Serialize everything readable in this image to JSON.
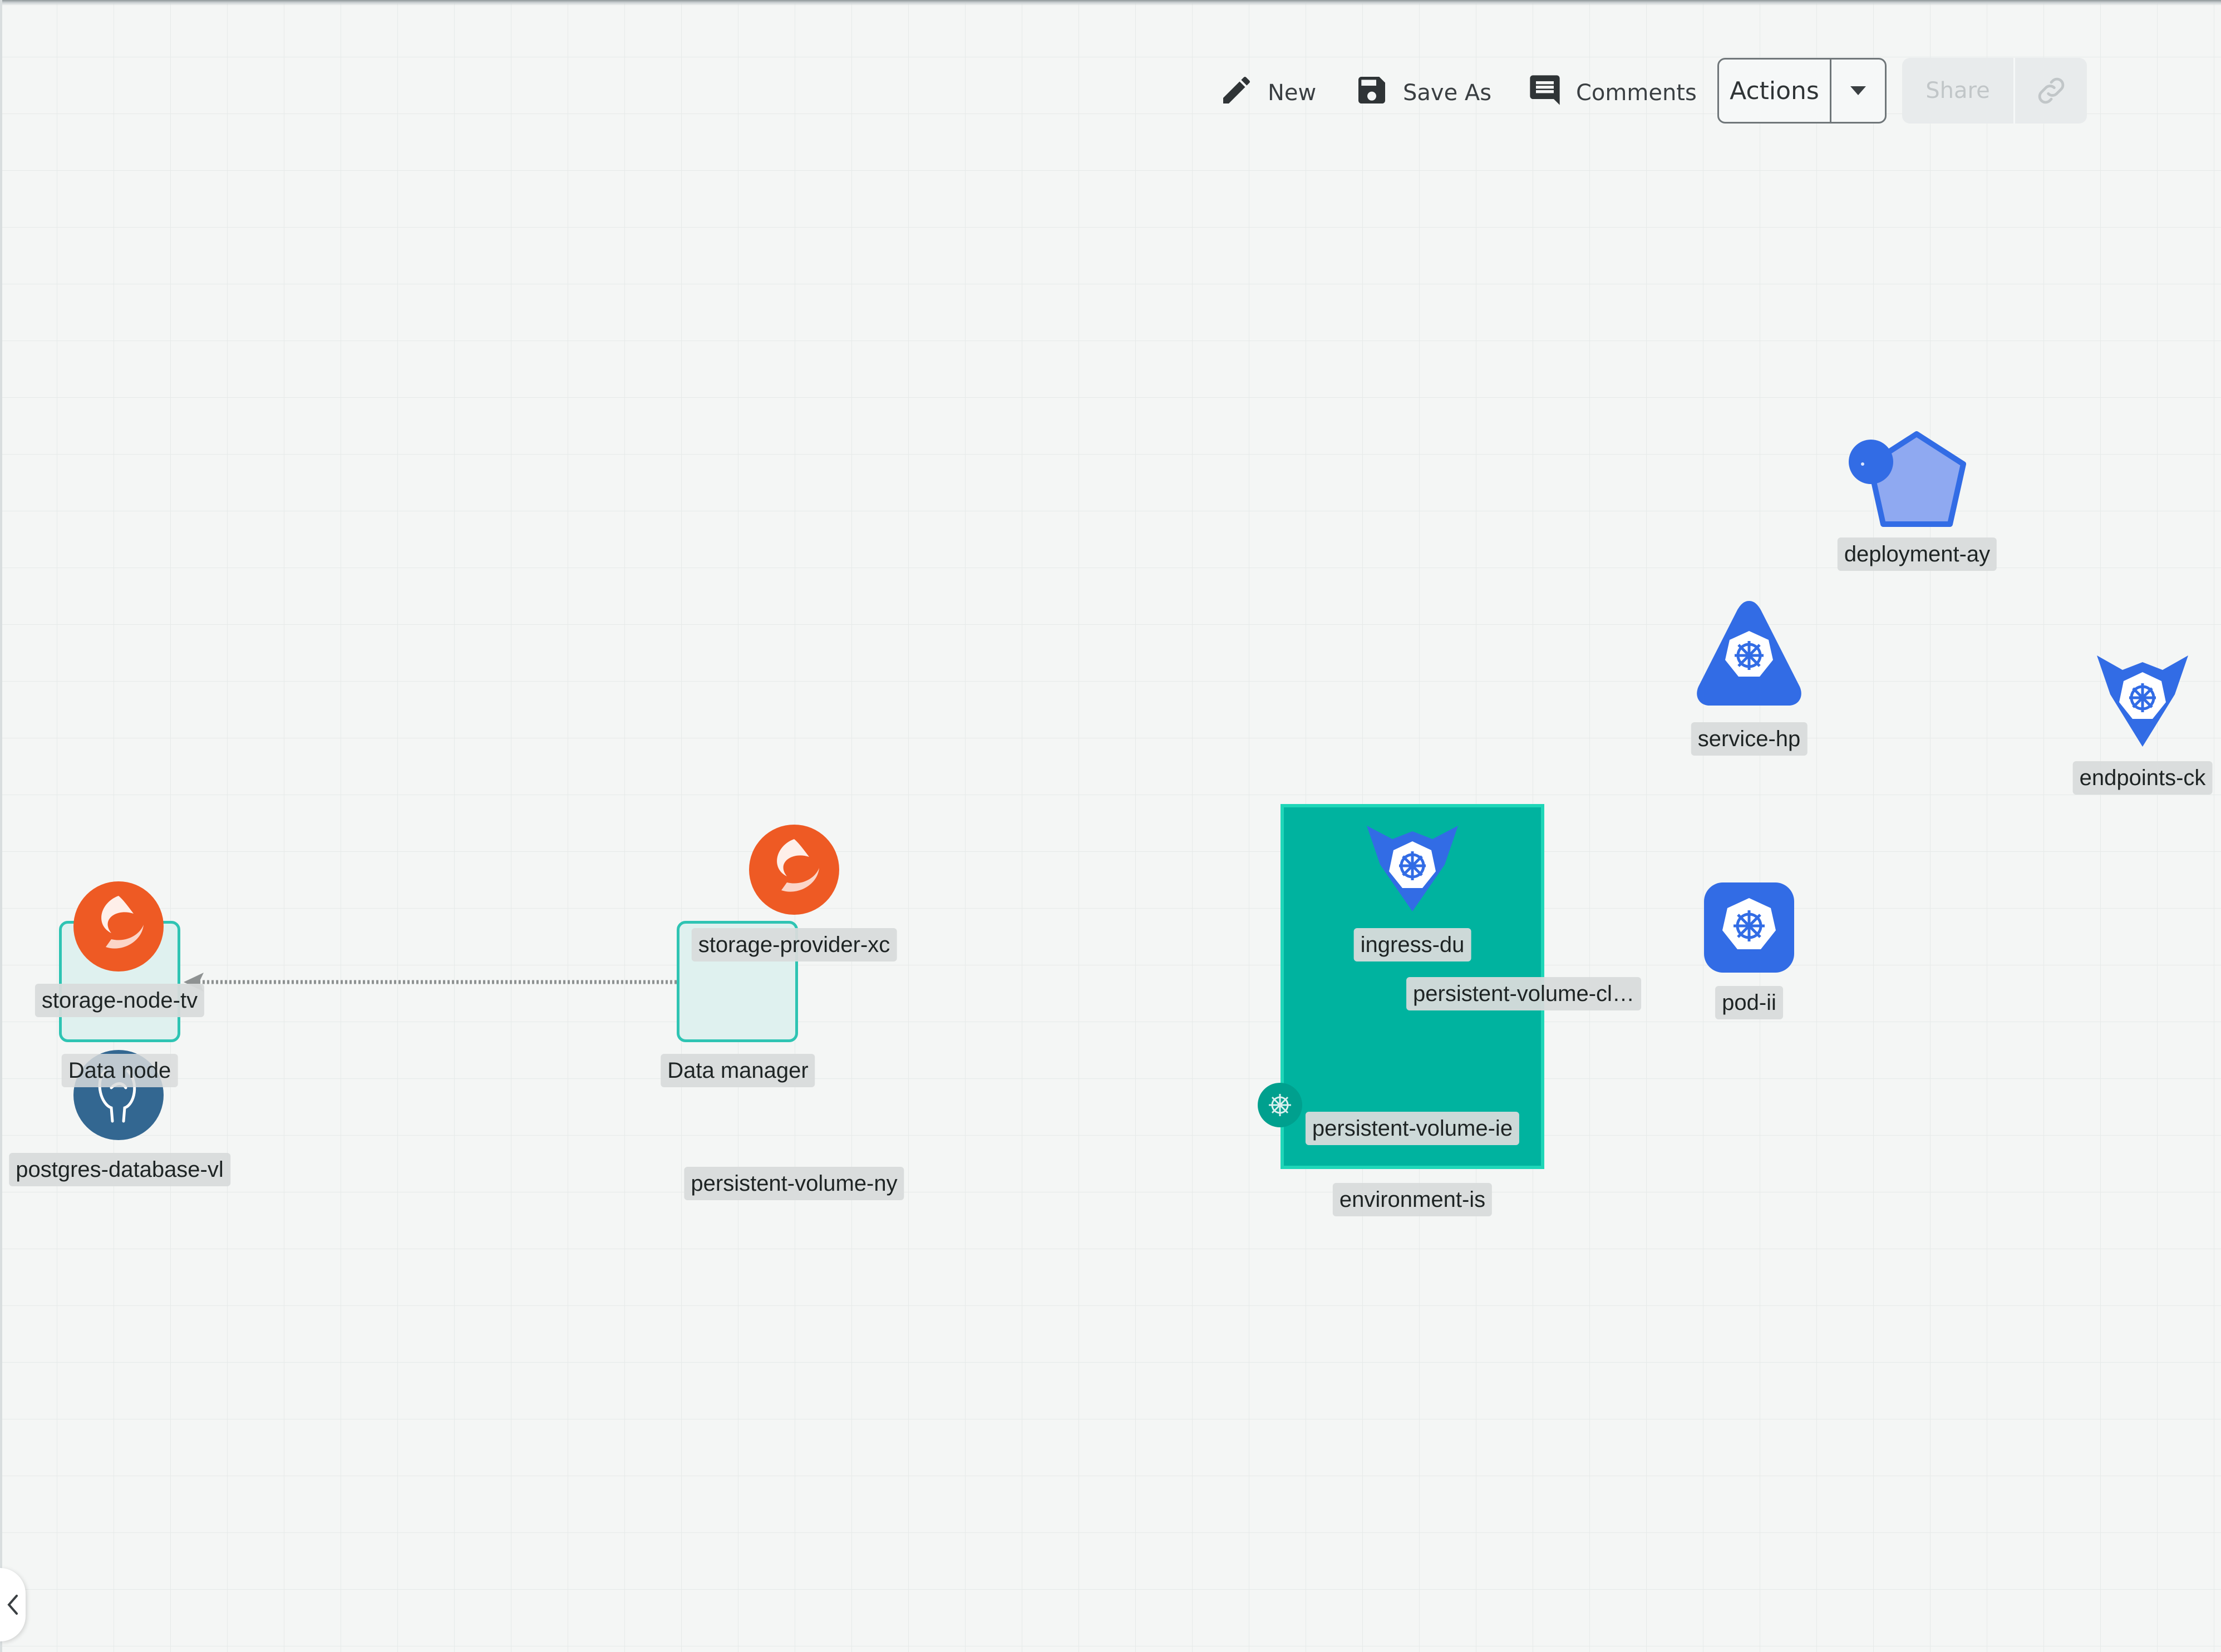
{
  "toolbar": {
    "new_label": "New",
    "save_as_label": "Save As",
    "comments_label": "Comments",
    "actions_label": "Actions",
    "share_label": "Share"
  },
  "diagram": {
    "nodes": {
      "storage_node": "storage-node-tv",
      "data_node": "Data node",
      "postgres": "postgres-database-vl",
      "storage_provider": "storage-provider-xc",
      "data_manager": "Data manager",
      "pv_ny": "persistent-volume-ny",
      "ingress": "ingress-du",
      "pv_claim": "persistent-volume-cl…",
      "pv_ie": "persistent-volume-ie",
      "environment": "environment-is",
      "deployment": "deployment-ay",
      "service": "service-hp",
      "endpoints": "endpoints-ck",
      "pod": "pod-ii"
    },
    "edges": [
      {
        "from": "Data manager",
        "to": "Data node",
        "style": "dotted-arrow"
      }
    ]
  },
  "colors": {
    "canvas": "#f4f6f5",
    "environment_fill": "#00b39f",
    "environment_border": "#1fd6b8",
    "kubernetes_blue": "#326ce5",
    "storage_orange": "#ee5a24",
    "postgres_blue": "#336791",
    "container_fill": "#dff1ef",
    "container_border": "#2ec4b3"
  },
  "icons": {
    "new": "pencil-icon",
    "save_as": "floppy-disk-icon",
    "comments": "comment-icon",
    "actions_dropdown": "caret-down-icon",
    "share_link": "link-icon",
    "collapse_panel": "chevron-left-icon"
  }
}
